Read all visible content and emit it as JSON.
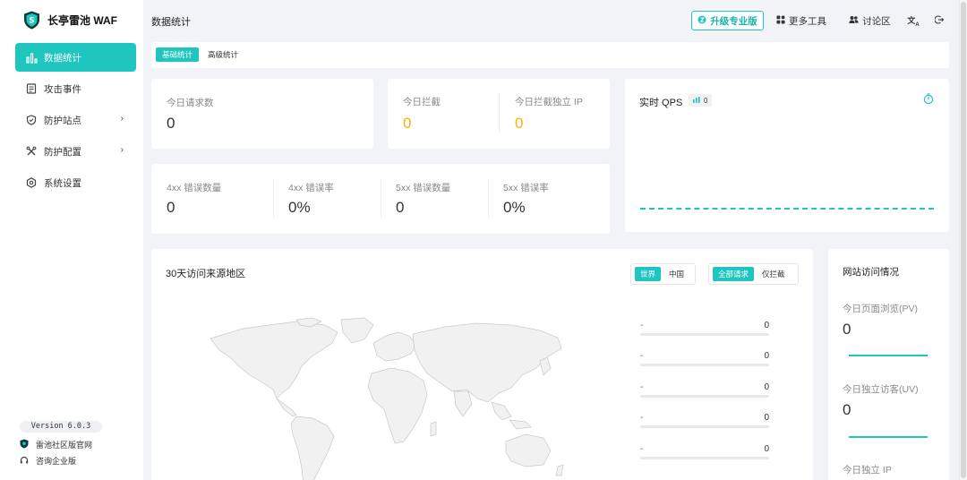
{
  "app": {
    "name": "长亭雷池 WAF",
    "version": "Version 6.0.3"
  },
  "sidebar": {
    "items": [
      {
        "label": "数据统计",
        "icon": "bar-chart-icon",
        "active": true
      },
      {
        "label": "攻击事件",
        "icon": "document-icon"
      },
      {
        "label": "防护站点",
        "icon": "shield-outline-icon",
        "expandable": true
      },
      {
        "label": "防护配置",
        "icon": "tools-icon",
        "expandable": true
      },
      {
        "label": "系统设置",
        "icon": "gear-icon"
      }
    ],
    "links": [
      {
        "label": "雷池社区版官网",
        "icon": "shield-logo-icon"
      },
      {
        "label": "咨询企业版",
        "icon": "headset-icon"
      }
    ]
  },
  "header": {
    "title": "数据统计",
    "upgrade_label": "升级专业版",
    "more_tools_label": "更多工具",
    "forum_label": "讨论区",
    "translate_icon": "translate-icon",
    "logout_icon": "logout-icon"
  },
  "tabs": [
    {
      "label": "基础统计",
      "active": true
    },
    {
      "label": "高级统计"
    }
  ],
  "stats": {
    "today_requests": {
      "label": "今日请求数",
      "value": "0"
    },
    "today_blocked": {
      "label": "今日拦截",
      "value": "0"
    },
    "today_blocked_ip": {
      "label": "今日拦截独立 IP",
      "value": "0"
    },
    "err_4xx_count": {
      "label": "4xx 错误数量",
      "value": "0"
    },
    "err_4xx_rate": {
      "label": "4xx 错误率",
      "value": "0%"
    },
    "err_5xx_count": {
      "label": "5xx 错误数量",
      "value": "0"
    },
    "err_5xx_rate": {
      "label": "5xx 错误率",
      "value": "0%"
    }
  },
  "qps": {
    "title": "实时 QPS",
    "badge_value": "0"
  },
  "map": {
    "title": "30天访问来源地区",
    "scope_options": [
      "世界",
      "中国"
    ],
    "scope_selected": "世界",
    "filter_options": [
      "全部请求",
      "仅拦截"
    ],
    "filter_selected": "全部请求",
    "ranking": [
      {
        "name": "-",
        "value": "0"
      },
      {
        "name": "-",
        "value": "0"
      },
      {
        "name": "-",
        "value": "0"
      },
      {
        "name": "-",
        "value": "0"
      },
      {
        "name": "-",
        "value": "0"
      }
    ]
  },
  "site_access": {
    "title": "网站访问情况",
    "pv": {
      "label": "今日页面浏览(PV)",
      "value": "0"
    },
    "uv": {
      "label": "今日独立访客(UV)",
      "value": "0"
    },
    "ip": {
      "label": "今日独立 IP"
    }
  },
  "colors": {
    "accent": "#1ec6bf",
    "warning": "#f5b400",
    "background": "#f1f3f6"
  }
}
